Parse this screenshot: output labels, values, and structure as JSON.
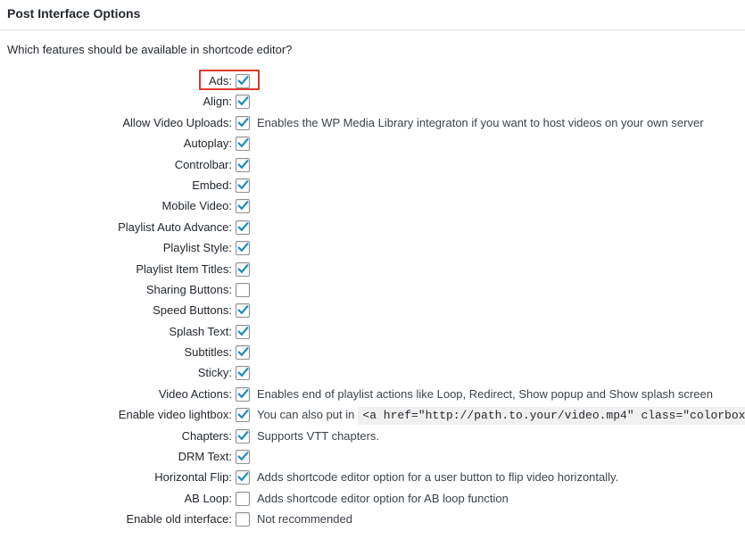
{
  "section": {
    "title": "Post Interface Options",
    "question": "Which features should be available in shortcode editor?"
  },
  "accent_color": "#1e8cbe",
  "highlight_color": "#e0392b",
  "options": [
    {
      "label": "Ads:",
      "checked": true,
      "desc": ""
    },
    {
      "label": "Align:",
      "checked": true,
      "desc": ""
    },
    {
      "label": "Allow Video Uploads:",
      "checked": true,
      "desc": "Enables the WP Media Library integraton if you want to host videos on your own server"
    },
    {
      "label": "Autoplay:",
      "checked": true,
      "desc": ""
    },
    {
      "label": "Controlbar:",
      "checked": true,
      "desc": ""
    },
    {
      "label": "Embed:",
      "checked": true,
      "desc": ""
    },
    {
      "label": "Mobile Video:",
      "checked": true,
      "desc": ""
    },
    {
      "label": "Playlist Auto Advance:",
      "checked": true,
      "desc": ""
    },
    {
      "label": "Playlist Style:",
      "checked": true,
      "desc": ""
    },
    {
      "label": "Playlist Item Titles:",
      "checked": true,
      "desc": ""
    },
    {
      "label": "Sharing Buttons:",
      "checked": false,
      "desc": ""
    },
    {
      "label": "Speed Buttons:",
      "checked": true,
      "desc": ""
    },
    {
      "label": "Splash Text:",
      "checked": true,
      "desc": ""
    },
    {
      "label": "Subtitles:",
      "checked": true,
      "desc": ""
    },
    {
      "label": "Sticky:",
      "checked": true,
      "desc": ""
    },
    {
      "label": "Video Actions:",
      "checked": true,
      "desc": "Enables end of playlist actions like Loop, Redirect, Show popup and Show splash screen"
    },
    {
      "label": "Enable video lightbox:",
      "checked": true,
      "desc": "You can also put in",
      "code": "<a href=\"http://path.to.your/video.mp4\" class=\"colorbox"
    },
    {
      "label": "Chapters:",
      "checked": true,
      "desc": "Supports VTT chapters."
    },
    {
      "label": "DRM Text:",
      "checked": true,
      "desc": ""
    },
    {
      "label": "Horizontal Flip:",
      "checked": true,
      "desc": "Adds shortcode editor option for a user button to flip video horizontally."
    },
    {
      "label": "AB Loop:",
      "checked": false,
      "desc": "Adds shortcode editor option for AB loop function"
    },
    {
      "label": "Enable old interface:",
      "checked": false,
      "desc": "Not recommended"
    }
  ]
}
